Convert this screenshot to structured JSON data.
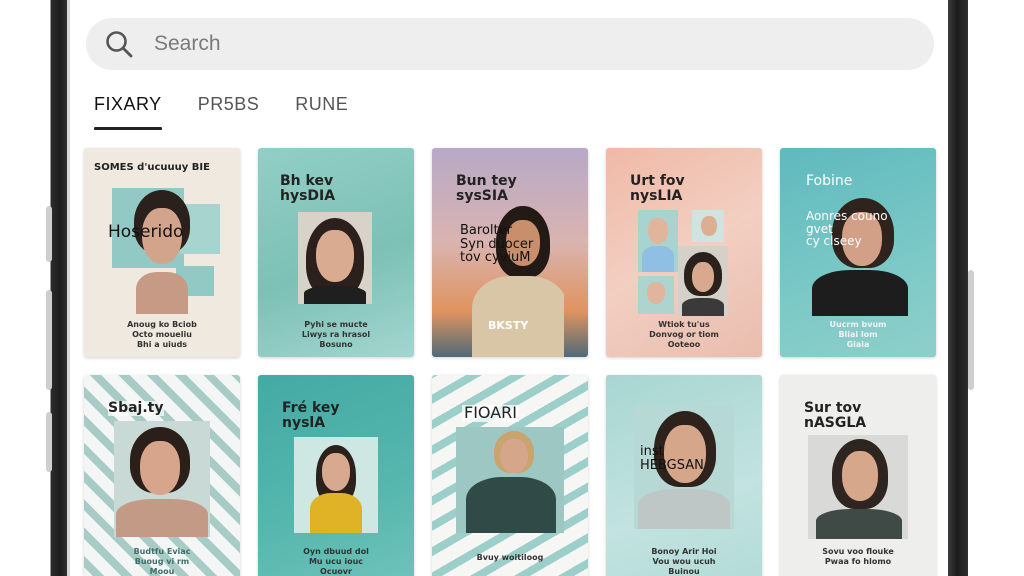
{
  "search": {
    "placeholder": "Search"
  },
  "tabs": [
    {
      "label": "FIXARY",
      "active": true
    },
    {
      "label": "PR5BS",
      "active": false
    },
    {
      "label": "RUNE",
      "active": false
    }
  ],
  "cards": [
    {
      "title": "SOMES d'ucuuuy BIE",
      "overlay": "Hoserido",
      "footer": "Anoug ko Bciob\nOcto moueliu\nBhi a uiuds"
    },
    {
      "title": "Bh    kev\nhysDIA",
      "footer": "Pyhi se mucte\nLiwys ra hrasol\nBosuno"
    },
    {
      "title": "Bun    tey\nsysSIA",
      "overlay": "Barolter\nSyn duocer\ntov cyviuM",
      "footer": "BKSTY"
    },
    {
      "title": "Urt    fov\nnysLIA",
      "footer": "Wtiok tu'us\nDonvog or tiom\nOoteoo"
    },
    {
      "title": "Fobine",
      "overlay": "Aonres couno\ngvet\ncy clseey",
      "footer": "Uucrm bvum\nBliai lom\nGiaia"
    },
    {
      "title": "Sbaj.ty",
      "footer": "Budtfu Eviac\nBuoug vi rm\nMoou"
    },
    {
      "title": "Fré    key\nnyslA",
      "footer": "Oyn dbuud dol\nMu ucu iouc\nOcuovr"
    },
    {
      "title": "FIOARI",
      "footer": "Bvuy woitiloog"
    },
    {
      "title": "",
      "overlay": "inst\nHEBGSAN",
      "footer": "Bonoy Arir Hoi\nVou wou ucuh\nBuinou"
    },
    {
      "title": "Sur    tov\nnASGLA",
      "footer": "Sovu voo flouke\nPwaa fo hlomo"
    }
  ],
  "colors": {
    "search_bg": "#eeeeee",
    "tab_active": "#111111",
    "tab_inactive": "#555555",
    "teal": "#7ec4bd",
    "frame": "#2a2a2a"
  }
}
